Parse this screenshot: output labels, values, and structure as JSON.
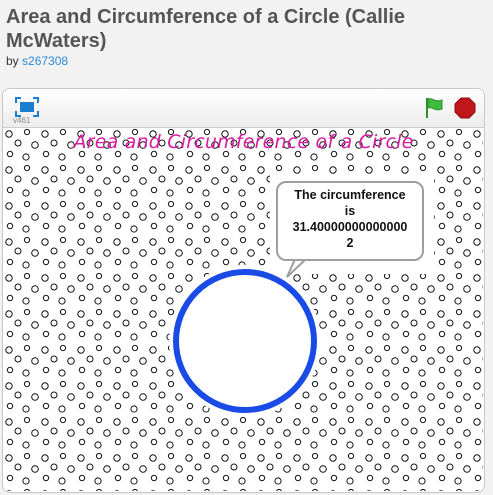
{
  "project": {
    "title": "Area and Circumference of a Circle (Callie McWaters)",
    "by_label": "by",
    "author": "s267308"
  },
  "player": {
    "version_label": "v461",
    "icons": {
      "fullscreen": "fullscreen-icon",
      "green_flag": "green-flag-icon",
      "stop": "stop-sign-icon"
    },
    "colors": {
      "fullscreen": "#1a7fd0",
      "flag": "#3dbd3d",
      "stop": "#c0161b"
    }
  },
  "stage": {
    "title_text": "Area and Circumference of a Circle",
    "title_color": "#d61ba0",
    "bubble": {
      "line1": "The circumference",
      "line2": "is",
      "line3": "31.40000000000000",
      "line4": "2"
    },
    "circle_color": "#1a4be6",
    "pattern": "dotted-circles"
  }
}
